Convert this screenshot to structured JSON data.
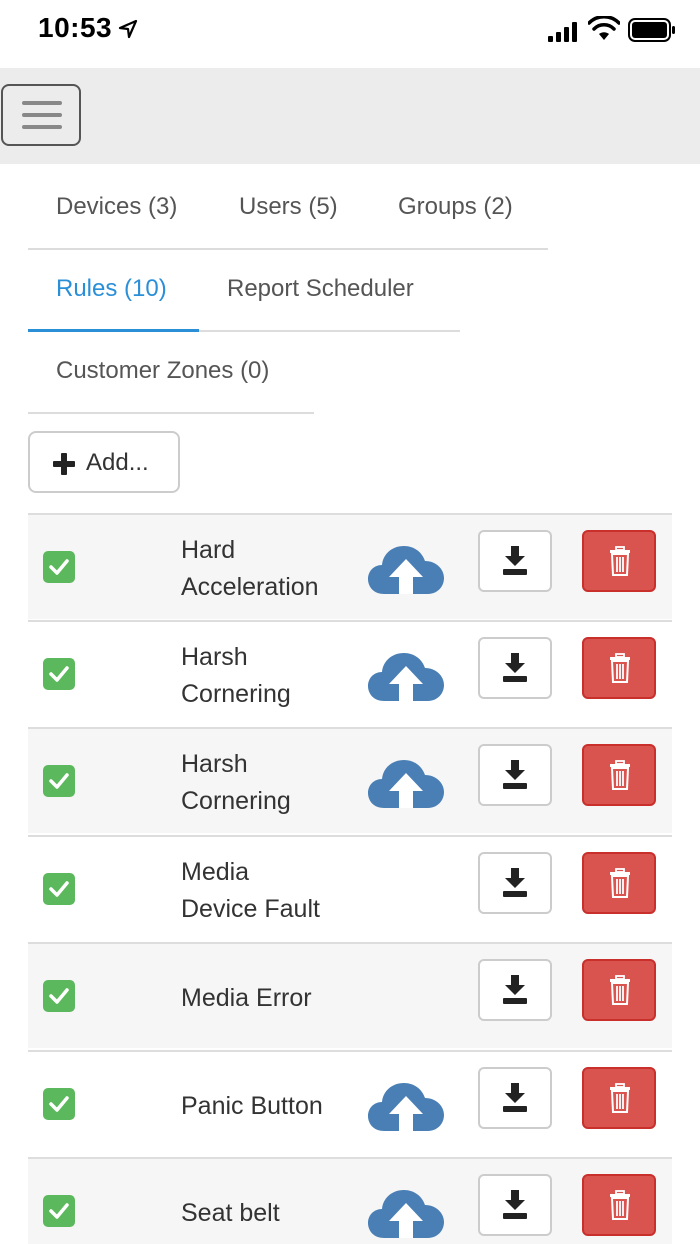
{
  "status_bar": {
    "time": "10:53",
    "icons": [
      "location-arrow-icon",
      "signal-icon",
      "wifi-icon",
      "battery-icon"
    ]
  },
  "navbar": {
    "menu_icon": "hamburger-menu-icon"
  },
  "tabs": {
    "row1": [
      {
        "label": "Devices (3)",
        "active": false
      },
      {
        "label": "Users (5)",
        "active": false
      },
      {
        "label": "Groups (2)",
        "active": false
      }
    ],
    "row2": [
      {
        "label": "Rules (10)",
        "active": true
      },
      {
        "label": "Report Scheduler",
        "active": false
      }
    ],
    "row3": [
      {
        "label": "Customer Zones (0)",
        "active": false
      }
    ]
  },
  "toolbar": {
    "add_label": "Add...",
    "add_icon": "plus-icon"
  },
  "rules": [
    {
      "name_line1": "Hard",
      "name_line2": "Acceleration",
      "checked": true,
      "cloud": true
    },
    {
      "name_line1": "Harsh",
      "name_line2": "Cornering",
      "checked": true,
      "cloud": true
    },
    {
      "name_line1": "Harsh",
      "name_line2": "Cornering",
      "checked": true,
      "cloud": true
    },
    {
      "name_line1": "Media",
      "name_line2": "Device Fault",
      "checked": true,
      "cloud": false
    },
    {
      "name_line1": "Media Error",
      "name_line2": "",
      "checked": true,
      "cloud": false
    },
    {
      "name_line1": "Panic Button",
      "name_line2": "",
      "checked": true,
      "cloud": true
    },
    {
      "name_line1": "Seat belt",
      "name_line2": "",
      "checked": true,
      "cloud": true
    }
  ],
  "colors": {
    "active_tab": "#2b8fd8",
    "checkbox": "#5cb85c",
    "cloud": "#4a7fb5",
    "delete": "#d9534f",
    "navbar_bg": "#ececec"
  }
}
